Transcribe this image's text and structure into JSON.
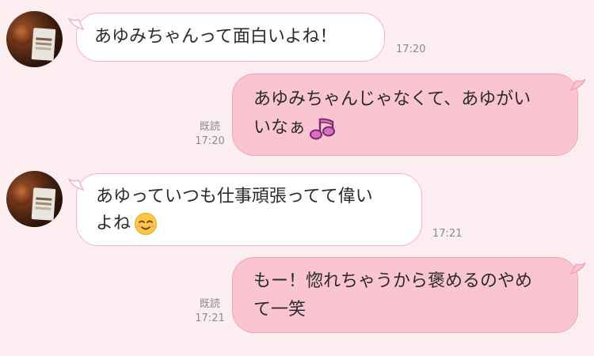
{
  "messages": [
    {
      "text": "あゆみちゃんって面白いよね！",
      "time": "17:20"
    },
    {
      "text_line1": "あゆみちゃんじゃなくて、あゆがい",
      "text_line2": "いなぁ",
      "icon": "music-note-icon",
      "read": "既読",
      "time": "17:20"
    },
    {
      "text_line1": "あゆっていつも仕事頑張ってて偉い",
      "text_line2": "よね",
      "icon": "smiling-face-icon",
      "time": "17:21"
    },
    {
      "text_line1": "もー！惚れちゃうから褒めるのやめ",
      "text_line2": "て一笑",
      "read": "既読",
      "time": "17:21"
    }
  ],
  "colors": {
    "background": "#fdeef2",
    "sent_bubble": "#fbc4d3",
    "received_bubble": "#ffffff",
    "bubble_border": "#f2b3c4"
  }
}
